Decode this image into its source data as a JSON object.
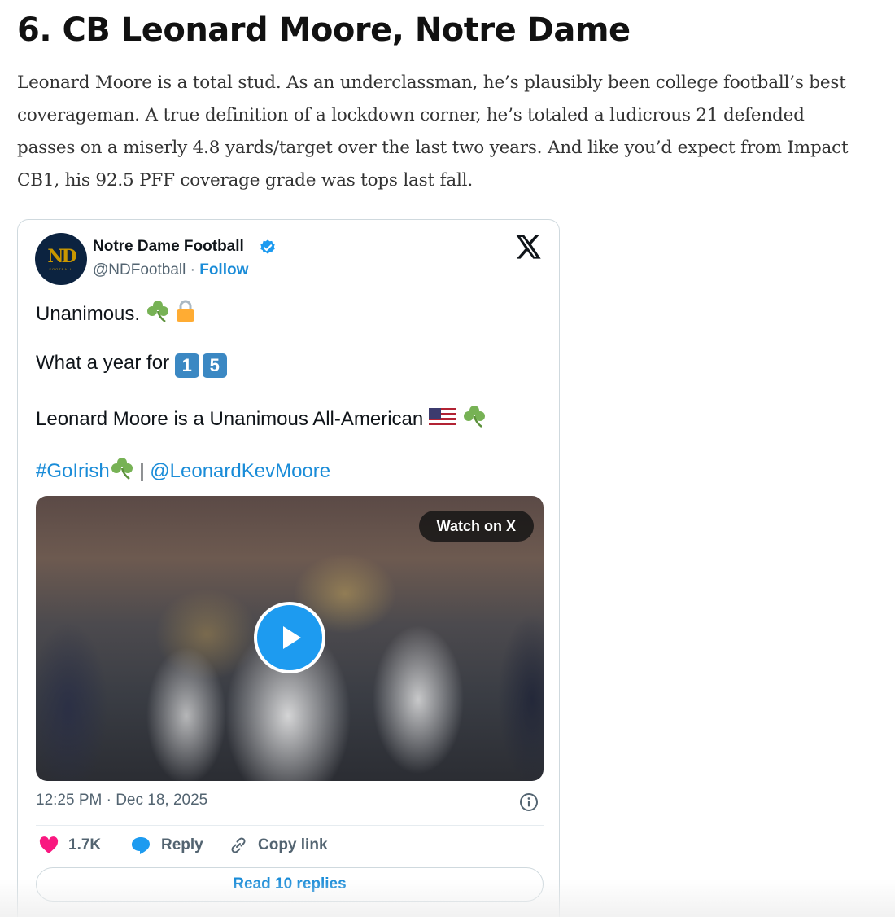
{
  "article": {
    "heading": "6. CB Leonard Moore, Notre Dame",
    "body_lines": [
      "Leonard Moore is a total stud. As an underclassman, he’s plausibly been college football’s best",
      "coverageman. A true definition of a lockdown corner, he’s totaled a ludicrous 21 defended",
      "passes on a miserly 4.8 yards/target over the last two years. And like you’d expect from Impact",
      "CB1, his 92.5 PFF coverage grade was tops last fall."
    ]
  },
  "tweet": {
    "account_name": "Notre Dame Football",
    "handle": "@NDFootball",
    "separator": " · ",
    "follow_label": "Follow",
    "line1": "Unanimous. ",
    "line2": "What a year for ",
    "keycaps": [
      "1",
      "5"
    ],
    "line3": "Leonard Moore is a Unanimous All-American ",
    "hashtag": "#GoIrish",
    "pipe": " | ",
    "mention": "@LeonardKevMoore",
    "media": {
      "watch_label": "Watch on X"
    },
    "timestamp": "12:25 PM · Dec 18, 2025",
    "actions": {
      "likes": "1.7K",
      "reply_label": "Reply",
      "copy_link_label": "Copy link"
    },
    "read_replies_label": "Read 10 replies",
    "icons": [
      "nd-logo-avatar",
      "verified-badge-icon",
      "x-logo-icon",
      "shamrock-icon",
      "lock-icon",
      "us-flag-icon",
      "play-icon",
      "info-icon",
      "heart-icon",
      "reply-bubble-icon",
      "link-icon"
    ],
    "colors": {
      "link_blue": "#1a8cd8",
      "verified_blue": "#1d9bf0",
      "like_pink": "#f91880",
      "nd_navy": "#0c2340",
      "nd_gold": "#c99700"
    }
  }
}
